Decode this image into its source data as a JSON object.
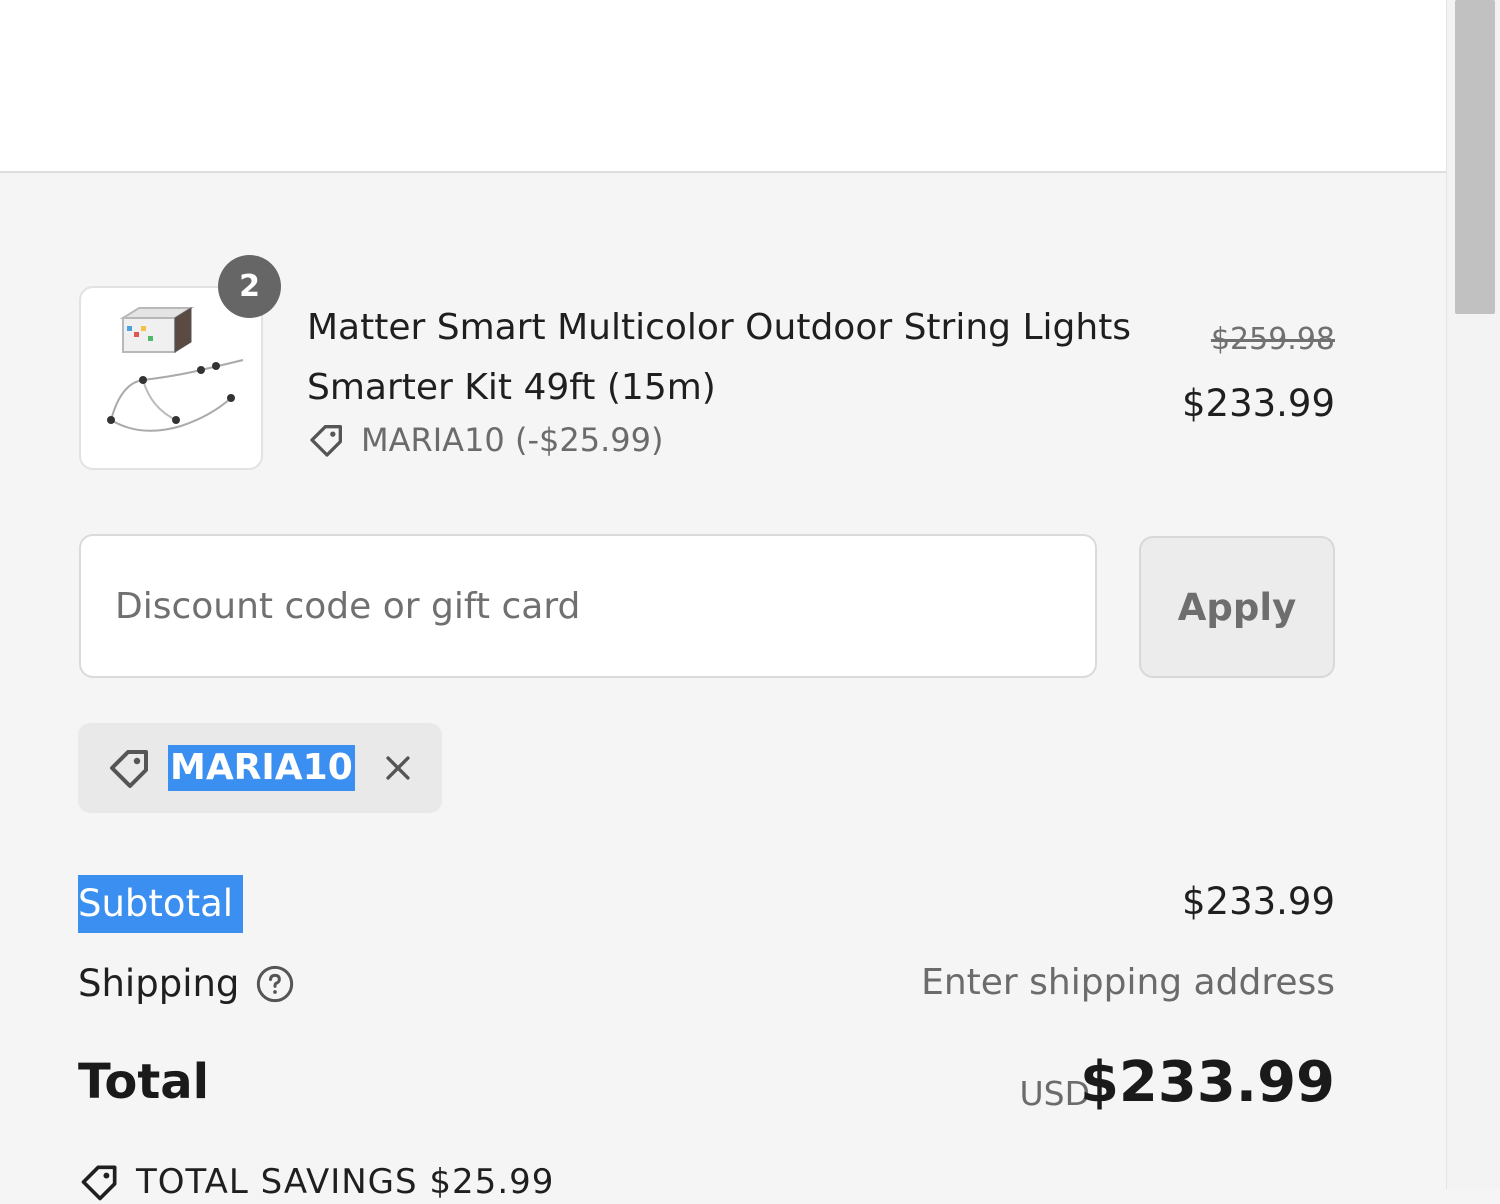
{
  "cart_item": {
    "quantity": "2",
    "title": "Matter Smart Multicolor Outdoor String Lights Smarter Kit 49ft (15m)",
    "discount_line": "MARIA10 (-$25.99)",
    "original_price": "$259.98",
    "price": "$233.99",
    "image_icon": "string-lights-product-image"
  },
  "discount": {
    "placeholder": "Discount code or gift card",
    "value": "",
    "apply_label": "Apply"
  },
  "applied_code": {
    "code": "MARIA10",
    "tag_icon": "tag-icon",
    "remove_icon": "close-icon"
  },
  "summary": {
    "subtotal_label": "Subtotal",
    "subtotal_value": "$233.99",
    "shipping_label": "Shipping",
    "shipping_value": "Enter shipping address",
    "total_label": "Total",
    "currency": "USD",
    "total_value": "$233.99",
    "savings_text": "TOTAL SAVINGS  $25.99"
  },
  "colors": {
    "selection": "#3b8ff0",
    "badge": "#666666",
    "background": "#f5f5f5"
  }
}
